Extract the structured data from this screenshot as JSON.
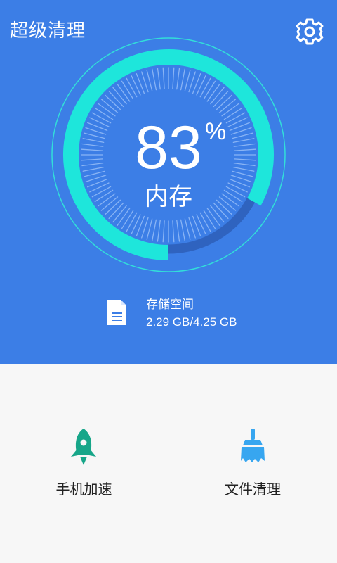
{
  "header": {
    "title": "超级清理",
    "settings_icon": "gear-icon"
  },
  "memory": {
    "percent": 83,
    "percent_text": "83",
    "percent_sign": "%",
    "label": "内存"
  },
  "storage": {
    "title": "存储空间",
    "value": "2.29 GB/4.25 GB",
    "icon": "document-icon"
  },
  "actions": [
    {
      "label": "手机加速",
      "icon": "rocket-icon",
      "color": "#17a689"
    },
    {
      "label": "文件清理",
      "icon": "broom-icon",
      "color": "#37a6f0"
    }
  ],
  "colors": {
    "header_background": "#3c7ee6",
    "gauge_progress": "#1ee6db",
    "gauge_remaining": "#2f63bf",
    "panel_background": "#f7f7f7"
  }
}
